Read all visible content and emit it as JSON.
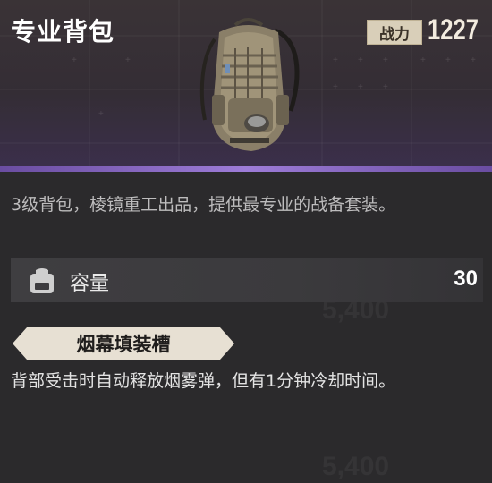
{
  "item": {
    "title": "专业背包",
    "power_label": "战力",
    "power_value": "1227",
    "image_icon": "backpack-icon",
    "description": "3级背包，棱镜重工出品，提供最专业的战备套装。"
  },
  "stat": {
    "icon": "backpack-capacity-icon",
    "label": "容量",
    "value": "30"
  },
  "feature": {
    "tag": "烟幕填装槽",
    "description": "背部受击时自动释放烟雾弹，但有1分钟冷却时间。"
  },
  "colors": {
    "accent_purple": "#9d7cd8",
    "badge_bg": "#d9cfb9",
    "tag_bg": "#e7e0d3"
  }
}
